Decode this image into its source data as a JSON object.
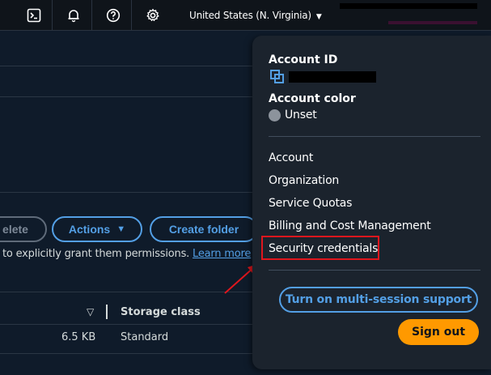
{
  "topnav": {
    "icons": [
      "cloudshell-icon",
      "bell-icon",
      "help-icon",
      "gear-icon"
    ],
    "region": "United States (N. Virginia)"
  },
  "toolbar": {
    "delete_label": "elete",
    "actions_label": "Actions",
    "actions_caret": "▼",
    "create_folder_label": "Create folder"
  },
  "permissions": {
    "text": "to explicitly grant them permissions.",
    "link": "Learn more",
    "tail": "["
  },
  "table": {
    "sort_icon": "▽",
    "header_storage_class": "Storage class",
    "row": {
      "size": "6.5 KB",
      "storage_class": "Standard"
    }
  },
  "account_menu": {
    "account_id_label": "Account ID",
    "account_color_label": "Account color",
    "account_color_value": "Unset",
    "items": [
      {
        "label": "Account"
      },
      {
        "label": "Organization"
      },
      {
        "label": "Service Quotas"
      },
      {
        "label": "Billing and Cost Management"
      },
      {
        "label": "Security credentials"
      }
    ],
    "multi_session_label": "Turn on multi-session support",
    "sign_out_label": "Sign out"
  },
  "colors": {
    "accent": "#539fe5",
    "signout": "#ff9900",
    "highlight": "#e0161d"
  }
}
